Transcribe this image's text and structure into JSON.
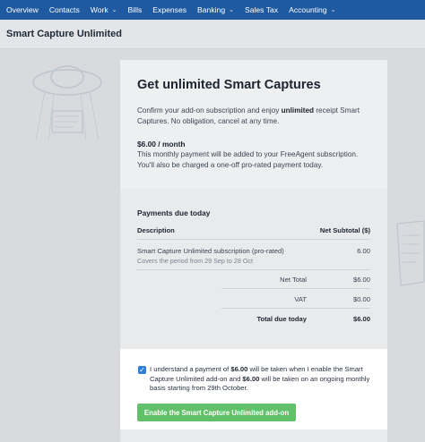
{
  "nav": {
    "items": [
      {
        "label": "Overview",
        "has_menu": false
      },
      {
        "label": "Contacts",
        "has_menu": false
      },
      {
        "label": "Work",
        "has_menu": true
      },
      {
        "label": "Bills",
        "has_menu": false
      },
      {
        "label": "Expenses",
        "has_menu": false
      },
      {
        "label": "Banking",
        "has_menu": true
      },
      {
        "label": "Sales Tax",
        "has_menu": false
      },
      {
        "label": "Accounting",
        "has_menu": true
      }
    ],
    "color": "#1f5aa0"
  },
  "page": {
    "title": "Smart Capture Unlimited"
  },
  "modal": {
    "title": "Get unlimited Smart Captures",
    "intro_before": "Confirm your add-on subscription and enjoy ",
    "intro_bold": "unlimited",
    "intro_after": " receipt Smart Captures. No obligation, cancel at any time.",
    "price": "$6.00 / month",
    "price_note": "This monthly payment will be added to your FreeAgent subscription. You'll also be charged a one-off pro-rated payment today.",
    "payments_title": "Payments due today",
    "table": {
      "col_description": "Description",
      "col_subtotal": "Net Subtotal ($)",
      "row": {
        "description": "Smart Capture Unlimited subscription (pro-rated)",
        "period": "Covers the period from 29 Sep to 28 Oct",
        "amount": "6.00"
      },
      "net_total_label": "Net Total",
      "net_total_value": "$6.00",
      "vat_label": "VAT",
      "vat_value": "$0.00",
      "total_label": "Total due today",
      "total_value": "$6.00"
    }
  },
  "confirm": {
    "checked": true,
    "text_1": "I understand a payment of ",
    "amount_1": "$6.00",
    "text_2": " will be taken when I enable the Smart Capture Unlimited add-on and ",
    "amount_2": "$6.00",
    "text_3": " will be taken on an ongoing monthly basis starting from 29th October.",
    "button_label": "Enable the Smart Capture Unlimited add-on",
    "button_color": "#62c06a"
  }
}
